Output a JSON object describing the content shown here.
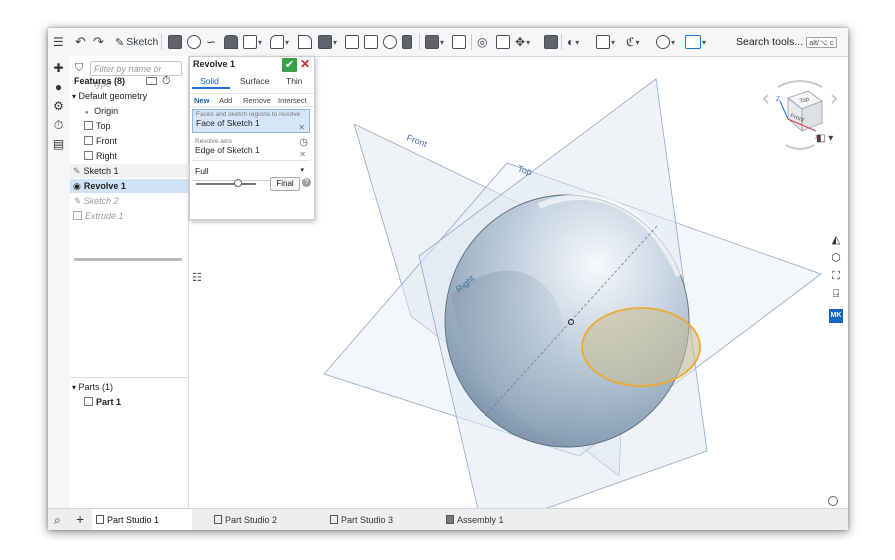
{
  "toolbar": {
    "sketch_label": "Sketch",
    "search_label": "Search tools...",
    "search_shortcut": "alt/⌥ c"
  },
  "features": {
    "filter_placeholder": "Filter by name or type",
    "header": "Features (8)",
    "items": [
      {
        "label": "Default geometry"
      },
      {
        "label": "Origin"
      },
      {
        "label": "Top"
      },
      {
        "label": "Front"
      },
      {
        "label": "Right"
      },
      {
        "label": "Sketch 1"
      },
      {
        "label": "Revolve 1"
      },
      {
        "label": "Sketch 2"
      },
      {
        "label": "Extrude 1"
      }
    ],
    "parts_header": "Parts (1)",
    "parts": [
      {
        "label": "Part 1"
      }
    ]
  },
  "dialog": {
    "title": "Revolve 1",
    "tabs": [
      "Solid",
      "Surface",
      "Thin"
    ],
    "ops": [
      "New",
      "Add",
      "Remove",
      "Intersect"
    ],
    "faces_label": "Faces and sketch regions to revolve",
    "faces_value": "Face of Sketch 1",
    "axis_label": "Revolve axis",
    "axis_value": "Edge of Sketch 1",
    "type_value": "Full",
    "final_label": "Final"
  },
  "viewport": {
    "plane_front": "Front",
    "plane_top": "Top",
    "plane_right": "Right"
  },
  "viewcube": {
    "top": "Top",
    "front": "Front",
    "axis_x": "X",
    "axis_z": "Z"
  },
  "right_tools": {
    "badge": "MK"
  },
  "tabbar": {
    "tabs": [
      {
        "label": "Part Studio 1"
      },
      {
        "label": "Part Studio 2"
      },
      {
        "label": "Part Studio 3"
      },
      {
        "label": "Assembly 1"
      }
    ]
  }
}
